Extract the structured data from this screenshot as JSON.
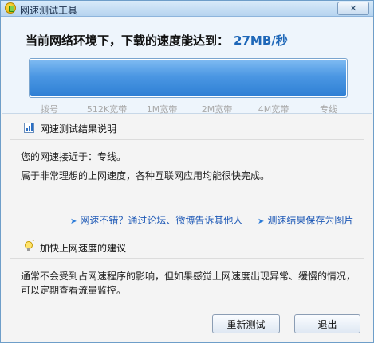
{
  "window": {
    "title": "网速测试工具",
    "close_label": "✕"
  },
  "result": {
    "prefix": "当前网络环境下，下载的速度能达到：",
    "speed": "27MB/秒",
    "fill_percent": 100,
    "ticks": [
      "拨号",
      "512K宽带",
      "1M宽带",
      "2M宽带",
      "4M宽带",
      "专线"
    ]
  },
  "explain": {
    "title": "网速测试结果说明",
    "line1": "您的网速接近于：专线。",
    "line2": "属于非常理想的上网速度，各种互联网应用均能很快完成。",
    "link_share": "网速不错？通过论坛、微博告诉其他人",
    "link_save": "测速结果保存为图片"
  },
  "advice": {
    "title": "加快上网速度的建议",
    "line1": "通常不会受到占网速程序的影响，但如果感觉上网速度出现异常、缓慢的情况，",
    "line2": "可以定期查看流量监控。"
  },
  "buttons": {
    "retest": "重新测试",
    "exit": "退出"
  }
}
